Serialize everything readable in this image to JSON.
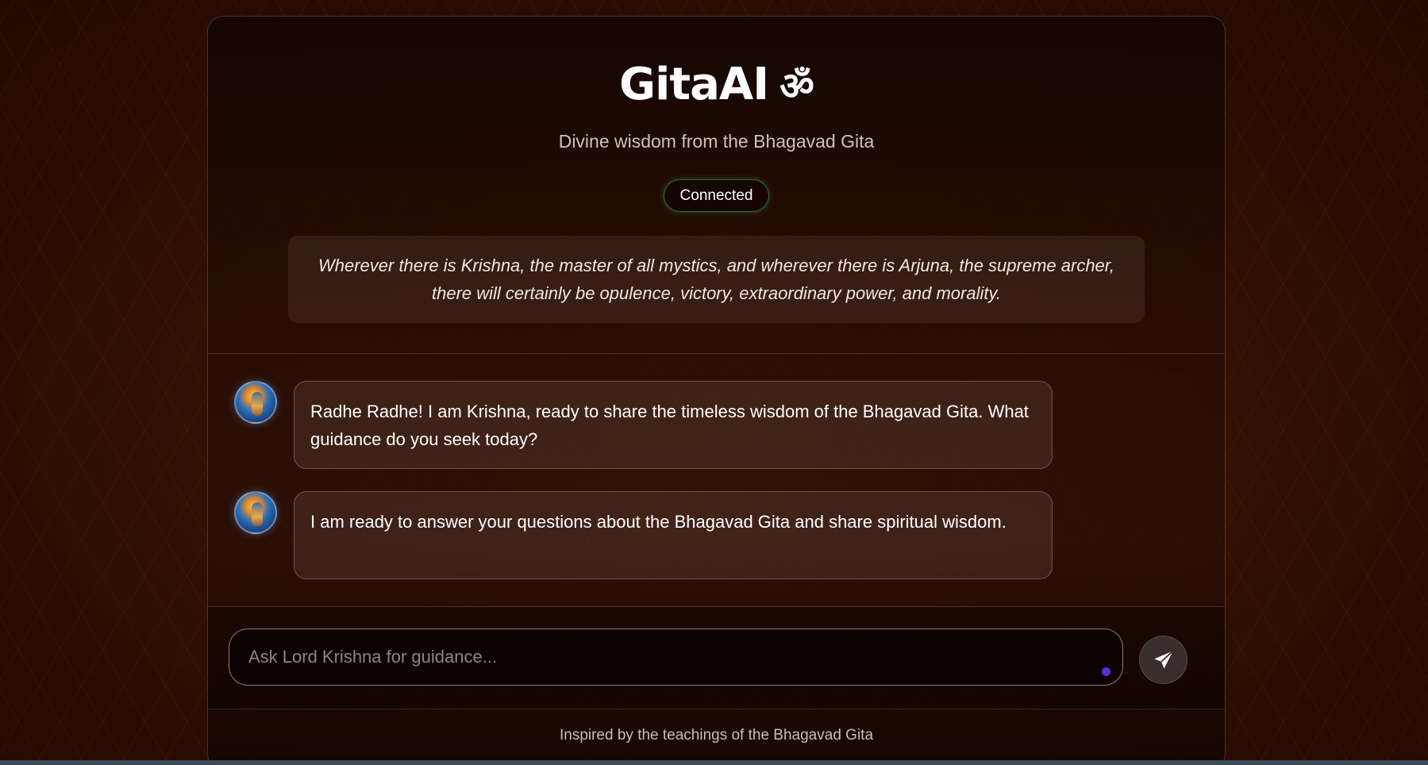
{
  "header": {
    "title": "GitaAI",
    "title_symbol": "ॐ",
    "subtitle": "Divine wisdom from the Bhagavad Gita",
    "status": "Connected",
    "quote": "Wherever there is Krishna, the master of all mystics, and wherever there is Arjuna, the supreme archer, there will certainly be opulence, victory, extraordinary power, and morality."
  },
  "messages": [
    {
      "sender_icon": "krishna-avatar-icon",
      "text": "Radhe Radhe! I am Krishna, ready to share the timeless wisdom of the Bhagavad Gita. What guidance do you seek today?"
    },
    {
      "sender_icon": "krishna-avatar-icon",
      "text": "I am ready to answer your questions about the Bhagavad Gita and share spiritual wisdom."
    }
  ],
  "input": {
    "placeholder": "Ask Lord Krishna for guidance...",
    "value": ""
  },
  "send_button": {
    "icon": "paper-plane-icon"
  },
  "footer": {
    "text": "Inspired by the teachings of the Bhagavad Gita"
  },
  "colors": {
    "background": "#3a1304",
    "status_border": "#2f6b3a",
    "input_dot": "#5b2be0",
    "send_button_bg": "#3a2e2b"
  }
}
